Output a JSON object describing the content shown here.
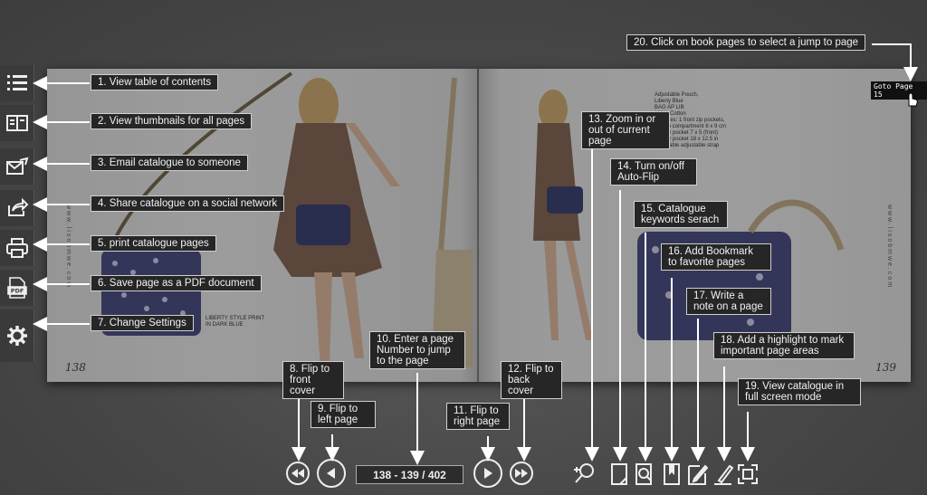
{
  "book": {
    "left_page_number": "138",
    "right_page_number": "139",
    "left_caption": "LIBERTY STYLE PRINT\nIN DARK BLUE",
    "right_product_text": "Adjustable Pouch,\nLiberty Blue\nBAG AP LIB\n100% Cotton\nFeatures: 1 front zip pockets,\n1 main compartment 6 x 9 cm\n1 inner pocket 7 x 5 (front)\n1 inner pocket 18 x 12.5 in\nadjustable adjustable strap"
  },
  "tooltip": "Goto Page 15",
  "toolbar": {
    "page_indicator": "138 - 139 / 402"
  },
  "callouts": {
    "c1": "1. View table of contents",
    "c2": "2. View thumbnails for all pages",
    "c3": "3. Email catalogue to someone",
    "c4": "4. Share catalogue on a social network",
    "c5": "5. print catalogue pages",
    "c6": "6. Save page as a PDF document",
    "c7": "7. Change Settings",
    "c8": "8. Flip to front cover",
    "c9": "9. Flip to left page",
    "c10": "10. Enter a page Number to jump to the page",
    "c11": "11. Flip to right page",
    "c12": "12. Flip to back cover",
    "c13": "13. Zoom in or out of current page",
    "c14": "14. Turn on/off Auto-Flip",
    "c15": "15. Catalogue keywords serach",
    "c16": "16. Add Bookmark to favorite pages",
    "c17": "17. Write a note on a page",
    "c18": "18. Add a highlight to mark important page areas",
    "c19": "19. View catalogue in full screen mode",
    "c20": "20. Click on book pages to select a  jump to page"
  },
  "icons": {
    "sidebar": [
      "list-icon",
      "thumbnails-icon",
      "email-icon",
      "share-icon",
      "print-icon",
      "pdf-icon",
      "settings-icon"
    ],
    "toolbar": [
      "first-page-icon",
      "prev-page-icon",
      "next-page-icon",
      "last-page-icon",
      "zoom-icon",
      "autoflip-icon",
      "search-icon",
      "bookmark-icon",
      "note-icon",
      "highlight-icon",
      "fullscreen-icon"
    ]
  },
  "colors": {
    "background": "#4a4a4a",
    "callout_bg": "#262626",
    "callout_border": "#cfcfcf",
    "icon": "#eeeeee"
  }
}
